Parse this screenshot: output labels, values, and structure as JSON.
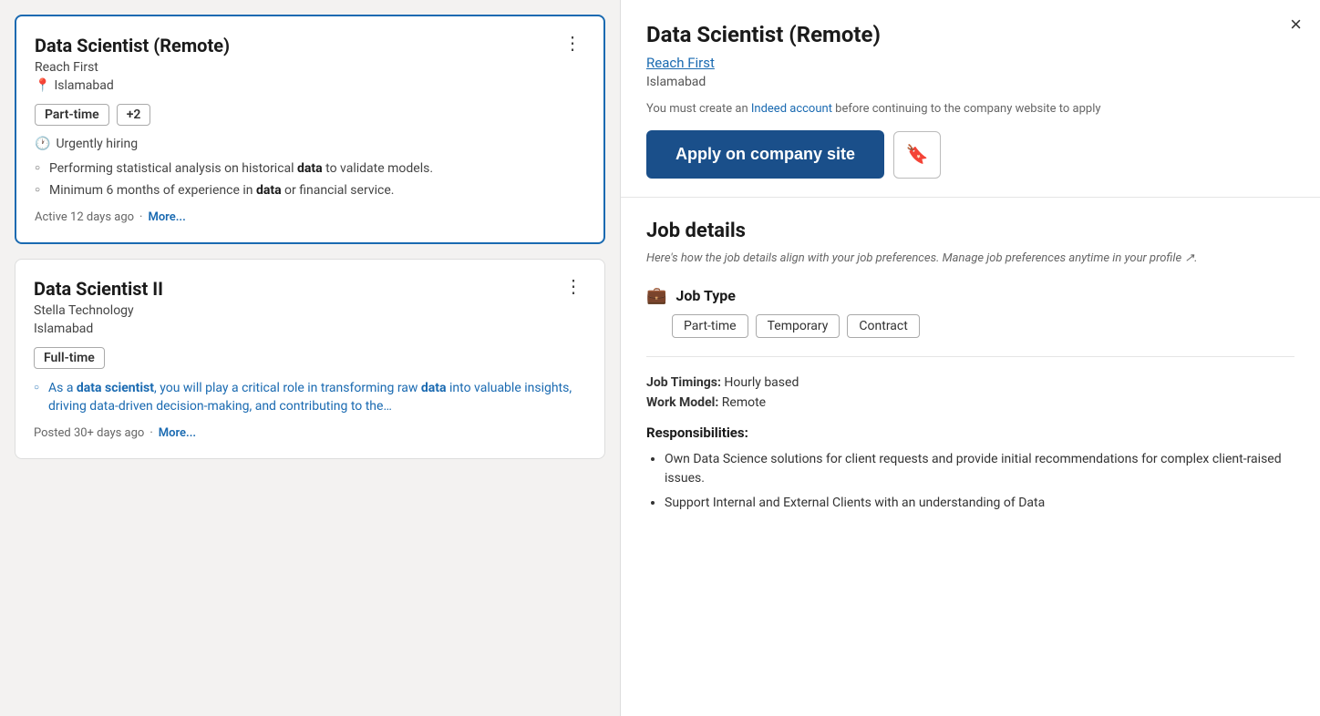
{
  "leftPanel": {
    "cards": [
      {
        "id": "card-1",
        "selected": true,
        "title": "Data Scientist (Remote)",
        "company": "Reach First",
        "location": "Islamabad",
        "tags": [
          "Part-time",
          "+2"
        ],
        "urgent": true,
        "urgentText": "Urgently hiring",
        "bullets": [
          {
            "text": "Performing statistical analysis on historical ",
            "bold": "data",
            "suffix": " to validate models."
          },
          {
            "text": "Minimum 6 months of experience in ",
            "bold": "data",
            "suffix": " or financial service."
          }
        ],
        "footer": "Active 12 days ago",
        "moreLabel": "More..."
      },
      {
        "id": "card-2",
        "selected": false,
        "title": "Data Scientist II",
        "company": "Stella Technology",
        "location": "Islamabad",
        "tags": [
          "Full-time"
        ],
        "urgent": false,
        "urgentText": "",
        "bullets": [
          {
            "text": "As a ",
            "bold": "data scientist",
            "suffix": ", you will play a critical role in transforming raw ",
            "bold2": "data",
            "suffix2": " into valuable insights, driving data-driven decision-making, and contributing to the…"
          }
        ],
        "footer": "Posted 30+ days ago",
        "moreLabel": "More..."
      }
    ]
  },
  "rightPanel": {
    "title": "Data Scientist (Remote)",
    "companyLink": "Reach First",
    "location": "Islamabad",
    "alertText": "You must create an Indeed account before continuing to the company website to apply",
    "alertLinkText": "Indeed account",
    "applyLabel": "Apply on company site",
    "saveIconLabel": "🔖",
    "jobDetails": {
      "sectionTitle": "Job details",
      "subtitle": "Here's how the job details align with your job preferences. Manage job preferences anytime in your profile ↗.",
      "jobTypeLabel": "Job Type",
      "jobTypeTags": [
        "Part-time",
        "Temporary",
        "Contract"
      ],
      "jobTimingsLabel": "Job Timings:",
      "jobTimingsValue": "Hourly based",
      "workModelLabel": "Work Model:",
      "workModelValue": "Remote",
      "responsibilitiesTitle": "Responsibilities:",
      "responsibilities": [
        "Own Data Science solutions for client requests and provide initial recommendations for complex client-raised issues.",
        "Support Internal and External Clients with an understanding of Data"
      ]
    },
    "closeLabel": "×"
  }
}
